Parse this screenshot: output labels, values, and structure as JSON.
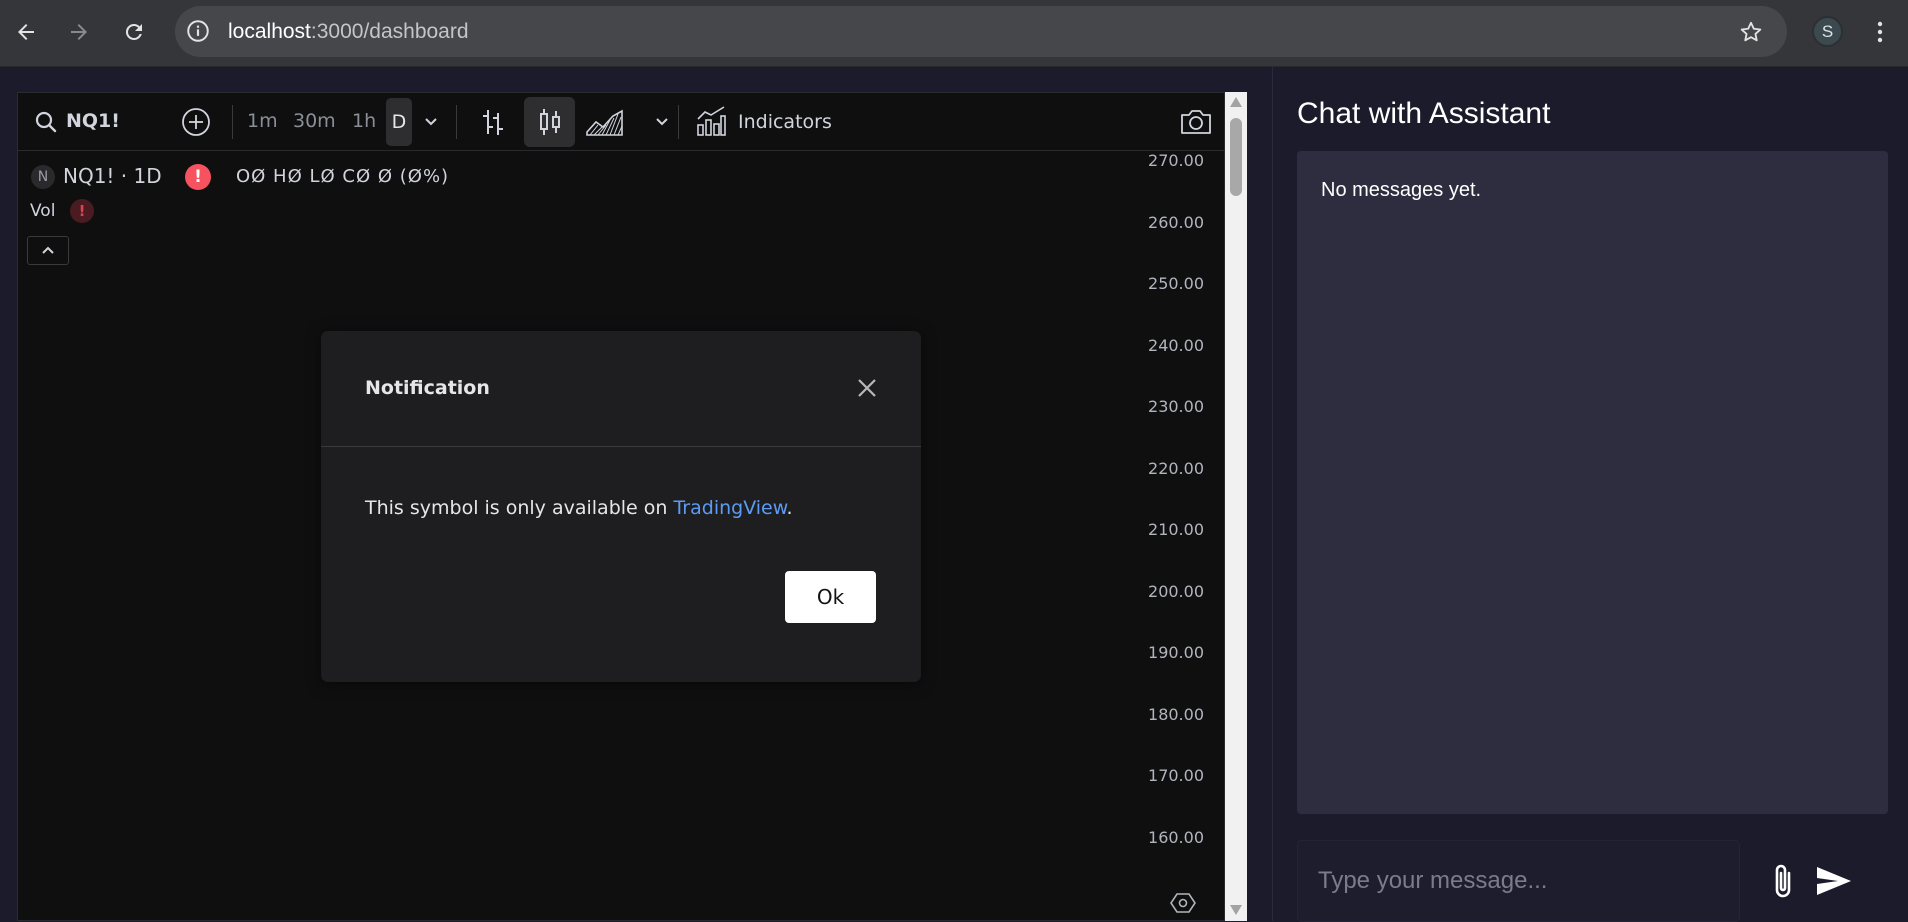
{
  "browser": {
    "url_host": "localhost",
    "url_path": ":3000/dashboard",
    "profile_initial": "S"
  },
  "chart": {
    "symbol_search": "NQ1!",
    "intervals": [
      "1m",
      "30m",
      "1h",
      "D"
    ],
    "active_interval": "D",
    "indicators_label": "Indicators",
    "legend": {
      "symbol_badge": "N",
      "title": "NQ1! · 1D",
      "ohlc": "OØ HØ LØ CØ Ø (Ø%)",
      "volume_label": "Vol"
    },
    "price_ticks": [
      "270.00",
      "260.00",
      "250.00",
      "240.00",
      "230.00",
      "220.00",
      "210.00",
      "200.00",
      "190.00",
      "180.00",
      "170.00",
      "160.00"
    ]
  },
  "modal": {
    "title": "Notification",
    "message_prefix": "This symbol is only available on ",
    "link_text": "TradingView",
    "message_suffix": ".",
    "ok_label": "Ok"
  },
  "chat": {
    "title": "Chat with Assistant",
    "empty_message": "No messages yet.",
    "input_placeholder": "Type your message..."
  },
  "colors": {
    "page_background": "#1c1b2b",
    "chart_background": "#0f0f10",
    "link": "#5b9cf5",
    "alert_red": "#f7525f",
    "messages_box": "#2e2c3f"
  }
}
